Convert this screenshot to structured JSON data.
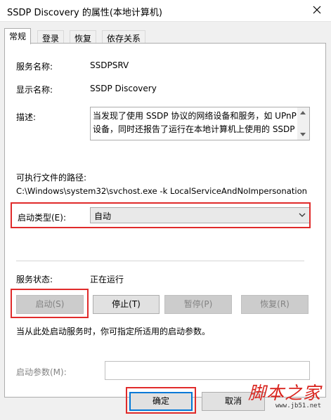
{
  "window": {
    "title": "SSDP Discovery 的属性(本地计算机)"
  },
  "tabs": [
    {
      "label": "常规",
      "active": true
    },
    {
      "label": "登录",
      "active": false
    },
    {
      "label": "恢复",
      "active": false
    },
    {
      "label": "依存关系",
      "active": false
    }
  ],
  "general": {
    "service_name_label": "服务名称:",
    "service_name_value": "SSDPSRV",
    "display_name_label": "显示名称:",
    "display_name_value": "SSDP Discovery",
    "description_label": "描述:",
    "description_text": "当发现了使用 SSDP 协议的网络设备和服务，如 UPnP 设备，同时还报告了运行在本地计算机上使用的 SSDP",
    "exe_path_label": "可执行文件的路径:",
    "exe_path_value": "C:\\Windows\\system32\\svchost.exe -k LocalServiceAndNoImpersonation",
    "startup_type_label": "启动类型(E):",
    "startup_type_value": "自动",
    "service_status_label": "服务状态:",
    "service_status_value": "正在运行",
    "start_button": "启动(S)",
    "stop_button": "停止(T)",
    "pause_button": "暂停(P)",
    "resume_button": "恢复(R)",
    "hint_text": "当从此处启动服务时，你可指定所适用的启动参数。",
    "start_params_label": "启动参数(M):",
    "start_params_value": ""
  },
  "footer": {
    "ok_button": "确定",
    "cancel_button": "取消"
  },
  "watermark": {
    "text": "脚本之家",
    "url": "www.jb51.net"
  },
  "colors": {
    "highlight_red": "#e02b2b",
    "focus_blue": "#0078d7",
    "watermark_red": "#d9231d"
  }
}
